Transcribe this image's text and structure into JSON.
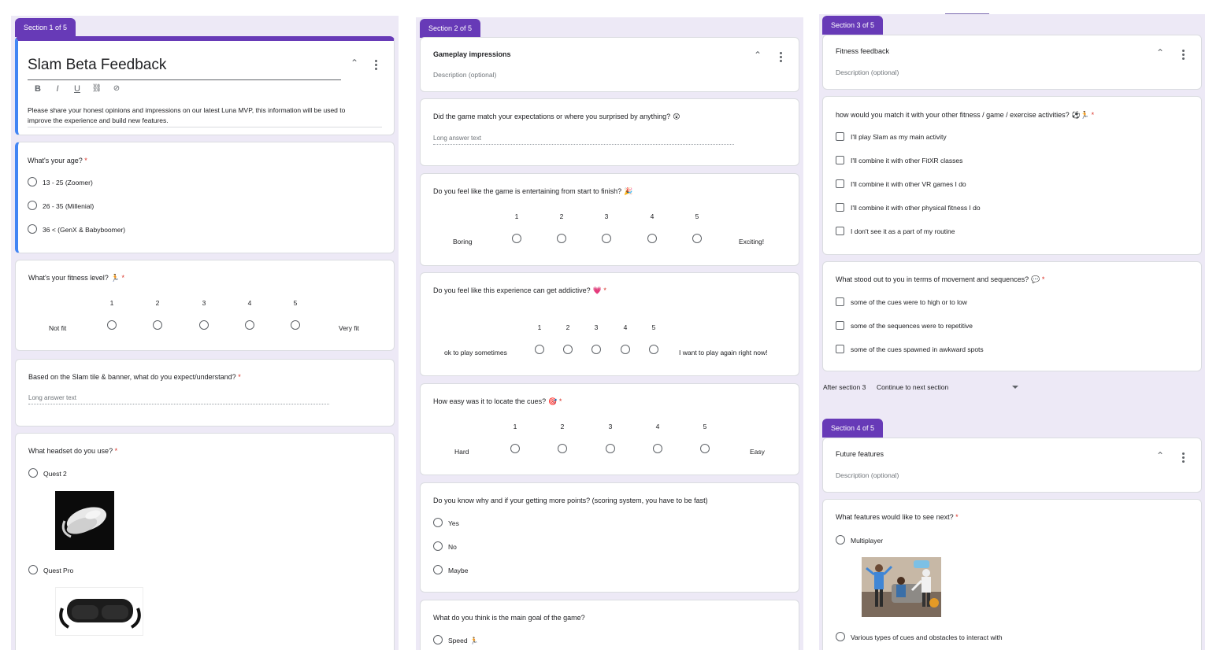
{
  "col1": {
    "section_label": "Section 1 of 5",
    "form_title": "Slam Beta Feedback",
    "format_buttons": [
      "B",
      "I",
      "U",
      "⛓",
      "⊘"
    ],
    "description_line1": "Please share your honest opinions and impressions on our latest Luna MVP, this information will be used to",
    "description_line2": "improve the experience and build new features.",
    "age": {
      "question": "What's your age?",
      "options": [
        "13 - 25 (Zoomer)",
        "26 - 35 (Millenial)",
        "36 < (GenX & Babyboomer)"
      ]
    },
    "fitness": {
      "question": "What's your fitness level?",
      "emoji": "🏃",
      "scale": [
        "1",
        "2",
        "3",
        "4",
        "5"
      ],
      "low_label": "Not fit",
      "high_label": "Very fit"
    },
    "expect": {
      "question": "Based on the Slam tile & banner, what do you expect/understand?",
      "placeholder": "Long answer text"
    },
    "headset": {
      "question": "What headset do you use?",
      "options": [
        "Quest 2",
        "Quest Pro"
      ]
    }
  },
  "col2": {
    "section_label": "Section 2 of 5",
    "section_title": "Gameplay impressions",
    "section_desc": "Description (optional)",
    "q_expect": {
      "question": "Did the game match your expectations or where you surprised by anything?",
      "emoji": "😲",
      "placeholder": "Long answer text"
    },
    "q_entertain": {
      "question": "Do you feel like the game is entertaining from start to finish?",
      "emoji": "🎉",
      "scale": [
        "1",
        "2",
        "3",
        "4",
        "5"
      ],
      "low_label": "Boring",
      "high_label": "Exciting!"
    },
    "q_addictive": {
      "question": "Do you feel like this experience can get addictive?",
      "emoji": "💗",
      "scale": [
        "1",
        "2",
        "3",
        "4",
        "5"
      ],
      "low_label": "ok to play sometimes",
      "high_label": "I want to play again right now!"
    },
    "q_locate": {
      "question": "How easy was it to locate the cues?",
      "emoji": "🎯",
      "scale": [
        "1",
        "2",
        "3",
        "4",
        "5"
      ],
      "low_label": "Hard",
      "high_label": "Easy"
    },
    "q_points": {
      "question": "Do you know why and if your getting more points? (scoring system, you have to be fast)",
      "options": [
        "Yes",
        "No",
        "Maybe"
      ]
    },
    "q_goal": {
      "question": "What do you think is the main goal of the game?",
      "options": [
        "Speed"
      ],
      "emoji": "🏃"
    }
  },
  "col3": {
    "section3_label": "Section 3 of 5",
    "section3_title": "Fitness feedback",
    "section3_desc": "Description (optional)",
    "q_match": {
      "question": "how would you match it with your other fitness / game / exercise activities?",
      "emoji": "⚽🏃",
      "options": [
        "I'll play Slam as my main activity",
        "I'll combine it with other FitXR classes",
        "I'll combine it with other VR games I do",
        "I'll combine it with other physical fitness I do",
        "I don't see it as a part of my routine"
      ]
    },
    "q_stood": {
      "question": "What stood out to you in terms of movement and sequences?",
      "emoji": "💬",
      "options": [
        "some of the cues were to high or to low",
        "some of the sequences were to repetitive",
        "some of the cues spawned in awkward spots"
      ]
    },
    "after_label": "After section 3",
    "after_value": "Continue to next section",
    "section4_label": "Section 4 of 5",
    "section4_title": "Future features",
    "section4_desc": "Description (optional)",
    "q_features": {
      "question": "What features would like to see next?",
      "options": [
        "Multiplayer",
        "Various types of cues and obstacles to interact with"
      ]
    }
  },
  "required_mark": "*",
  "colors": {
    "accent": "#673ab7",
    "active_bar": "#4285f4",
    "required": "#d93025",
    "background": "#ede9f6"
  }
}
